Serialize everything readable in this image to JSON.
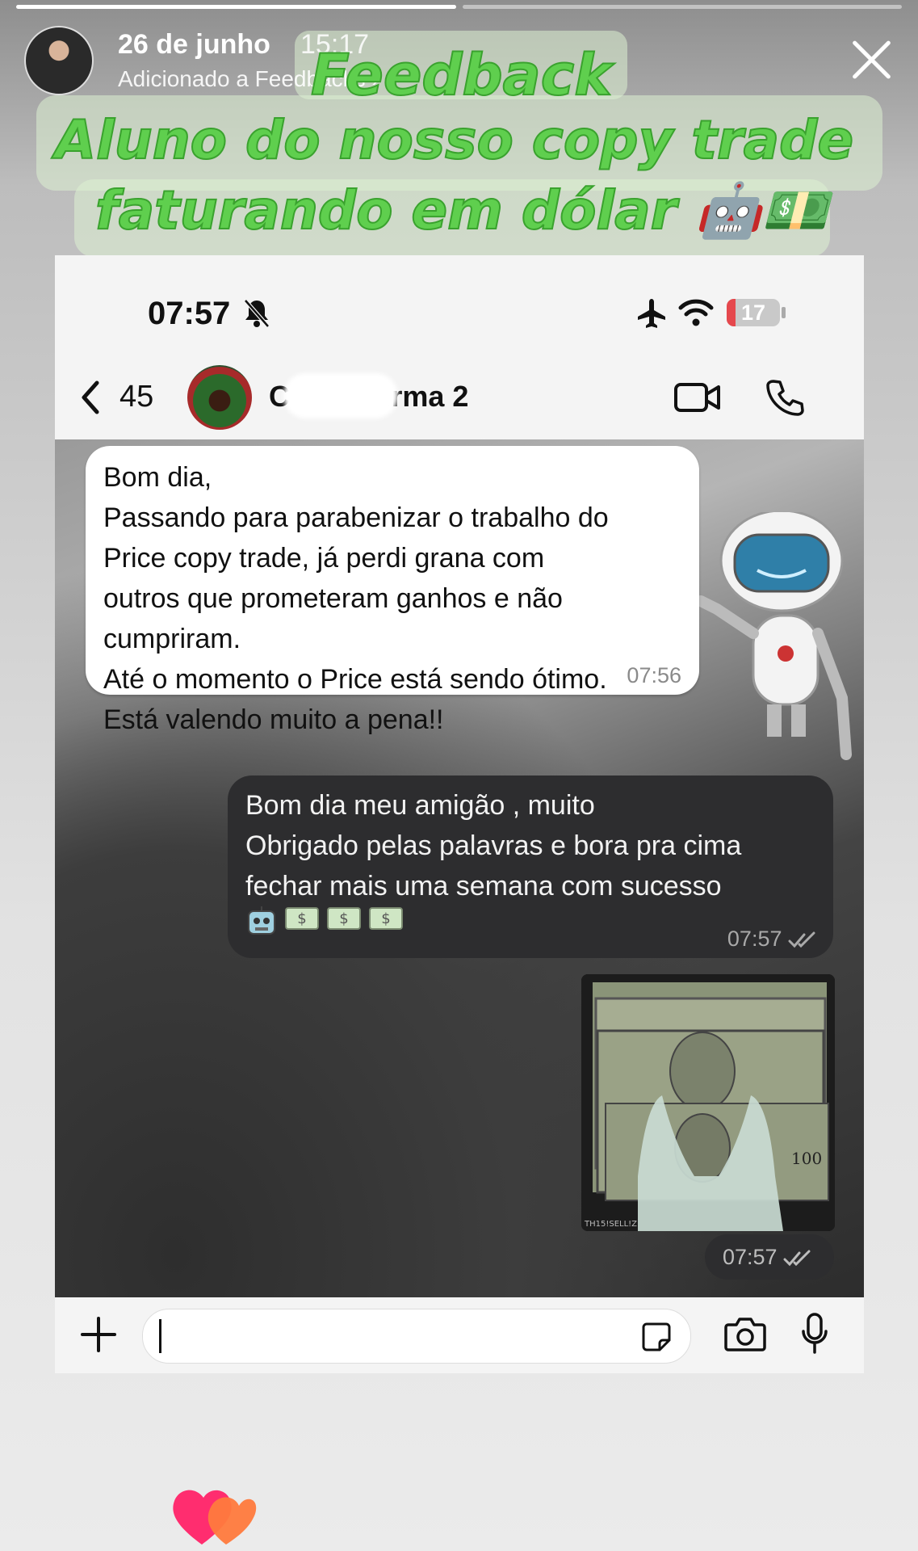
{
  "story": {
    "progress": [
      1.0,
      0.0
    ],
    "date": "26 de junho",
    "time": "15:17",
    "subtitle": "Adicionado a Feedbacks ›",
    "avatar_icon": "profile-avatar",
    "close_icon": "close-icon"
  },
  "headline": {
    "line1": "Feedback",
    "line2": "Aluno do nosso copy trade",
    "line3": "faturando em dólar 🤖💵"
  },
  "phone": {
    "status": {
      "time": "07:57",
      "battery": "17",
      "battery_fraction": 0.17
    },
    "chat": {
      "back_count": "45",
      "group_name": "C          opy Turma 2",
      "incoming": {
        "text": "Bom dia,\nPassando para parabenizar o trabalho do\nPrice copy trade, já perdi grana com\noutros que prometeram ganhos e não\ncumpriram.\nAté o momento o Price está sendo ótimo.\nEstá valendo muito a pena!!",
        "time": "07:56"
      },
      "outgoing": {
        "text": "Bom dia meu amigão , muito\nObrigado pelas palavras e bora pra cima\nfechar mais uma semana com sucesso",
        "emojis": [
          "robot",
          "money",
          "money",
          "money"
        ],
        "time": "07:57"
      },
      "photo": {
        "caption_time": "07:57",
        "watermark": "TH15!SELL!Z"
      }
    }
  },
  "colors": {
    "headline_green": "#5fcf4e",
    "outgoing_bubble": "#2d2d2f",
    "battery_red": "#e5484d"
  }
}
